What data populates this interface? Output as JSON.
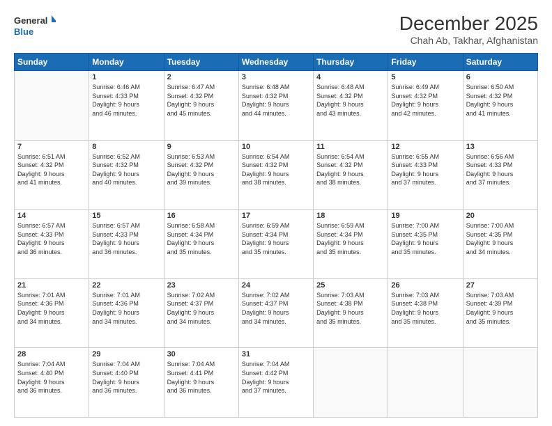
{
  "header": {
    "logo_line1": "General",
    "logo_line2": "Blue",
    "month": "December 2025",
    "location": "Chah Ab, Takhar, Afghanistan"
  },
  "weekdays": [
    "Sunday",
    "Monday",
    "Tuesday",
    "Wednesday",
    "Thursday",
    "Friday",
    "Saturday"
  ],
  "weeks": [
    [
      {
        "day": "",
        "info": ""
      },
      {
        "day": "1",
        "info": "Sunrise: 6:46 AM\nSunset: 4:33 PM\nDaylight: 9 hours\nand 46 minutes."
      },
      {
        "day": "2",
        "info": "Sunrise: 6:47 AM\nSunset: 4:32 PM\nDaylight: 9 hours\nand 45 minutes."
      },
      {
        "day": "3",
        "info": "Sunrise: 6:48 AM\nSunset: 4:32 PM\nDaylight: 9 hours\nand 44 minutes."
      },
      {
        "day": "4",
        "info": "Sunrise: 6:48 AM\nSunset: 4:32 PM\nDaylight: 9 hours\nand 43 minutes."
      },
      {
        "day": "5",
        "info": "Sunrise: 6:49 AM\nSunset: 4:32 PM\nDaylight: 9 hours\nand 42 minutes."
      },
      {
        "day": "6",
        "info": "Sunrise: 6:50 AM\nSunset: 4:32 PM\nDaylight: 9 hours\nand 41 minutes."
      }
    ],
    [
      {
        "day": "7",
        "info": "Sunrise: 6:51 AM\nSunset: 4:32 PM\nDaylight: 9 hours\nand 41 minutes."
      },
      {
        "day": "8",
        "info": "Sunrise: 6:52 AM\nSunset: 4:32 PM\nDaylight: 9 hours\nand 40 minutes."
      },
      {
        "day": "9",
        "info": "Sunrise: 6:53 AM\nSunset: 4:32 PM\nDaylight: 9 hours\nand 39 minutes."
      },
      {
        "day": "10",
        "info": "Sunrise: 6:54 AM\nSunset: 4:32 PM\nDaylight: 9 hours\nand 38 minutes."
      },
      {
        "day": "11",
        "info": "Sunrise: 6:54 AM\nSunset: 4:32 PM\nDaylight: 9 hours\nand 38 minutes."
      },
      {
        "day": "12",
        "info": "Sunrise: 6:55 AM\nSunset: 4:33 PM\nDaylight: 9 hours\nand 37 minutes."
      },
      {
        "day": "13",
        "info": "Sunrise: 6:56 AM\nSunset: 4:33 PM\nDaylight: 9 hours\nand 37 minutes."
      }
    ],
    [
      {
        "day": "14",
        "info": "Sunrise: 6:57 AM\nSunset: 4:33 PM\nDaylight: 9 hours\nand 36 minutes."
      },
      {
        "day": "15",
        "info": "Sunrise: 6:57 AM\nSunset: 4:33 PM\nDaylight: 9 hours\nand 36 minutes."
      },
      {
        "day": "16",
        "info": "Sunrise: 6:58 AM\nSunset: 4:34 PM\nDaylight: 9 hours\nand 35 minutes."
      },
      {
        "day": "17",
        "info": "Sunrise: 6:59 AM\nSunset: 4:34 PM\nDaylight: 9 hours\nand 35 minutes."
      },
      {
        "day": "18",
        "info": "Sunrise: 6:59 AM\nSunset: 4:34 PM\nDaylight: 9 hours\nand 35 minutes."
      },
      {
        "day": "19",
        "info": "Sunrise: 7:00 AM\nSunset: 4:35 PM\nDaylight: 9 hours\nand 35 minutes."
      },
      {
        "day": "20",
        "info": "Sunrise: 7:00 AM\nSunset: 4:35 PM\nDaylight: 9 hours\nand 34 minutes."
      }
    ],
    [
      {
        "day": "21",
        "info": "Sunrise: 7:01 AM\nSunset: 4:36 PM\nDaylight: 9 hours\nand 34 minutes."
      },
      {
        "day": "22",
        "info": "Sunrise: 7:01 AM\nSunset: 4:36 PM\nDaylight: 9 hours\nand 34 minutes."
      },
      {
        "day": "23",
        "info": "Sunrise: 7:02 AM\nSunset: 4:37 PM\nDaylight: 9 hours\nand 34 minutes."
      },
      {
        "day": "24",
        "info": "Sunrise: 7:02 AM\nSunset: 4:37 PM\nDaylight: 9 hours\nand 34 minutes."
      },
      {
        "day": "25",
        "info": "Sunrise: 7:03 AM\nSunset: 4:38 PM\nDaylight: 9 hours\nand 35 minutes."
      },
      {
        "day": "26",
        "info": "Sunrise: 7:03 AM\nSunset: 4:38 PM\nDaylight: 9 hours\nand 35 minutes."
      },
      {
        "day": "27",
        "info": "Sunrise: 7:03 AM\nSunset: 4:39 PM\nDaylight: 9 hours\nand 35 minutes."
      }
    ],
    [
      {
        "day": "28",
        "info": "Sunrise: 7:04 AM\nSunset: 4:40 PM\nDaylight: 9 hours\nand 36 minutes."
      },
      {
        "day": "29",
        "info": "Sunrise: 7:04 AM\nSunset: 4:40 PM\nDaylight: 9 hours\nand 36 minutes."
      },
      {
        "day": "30",
        "info": "Sunrise: 7:04 AM\nSunset: 4:41 PM\nDaylight: 9 hours\nand 36 minutes."
      },
      {
        "day": "31",
        "info": "Sunrise: 7:04 AM\nSunset: 4:42 PM\nDaylight: 9 hours\nand 37 minutes."
      },
      {
        "day": "",
        "info": ""
      },
      {
        "day": "",
        "info": ""
      },
      {
        "day": "",
        "info": ""
      }
    ]
  ]
}
